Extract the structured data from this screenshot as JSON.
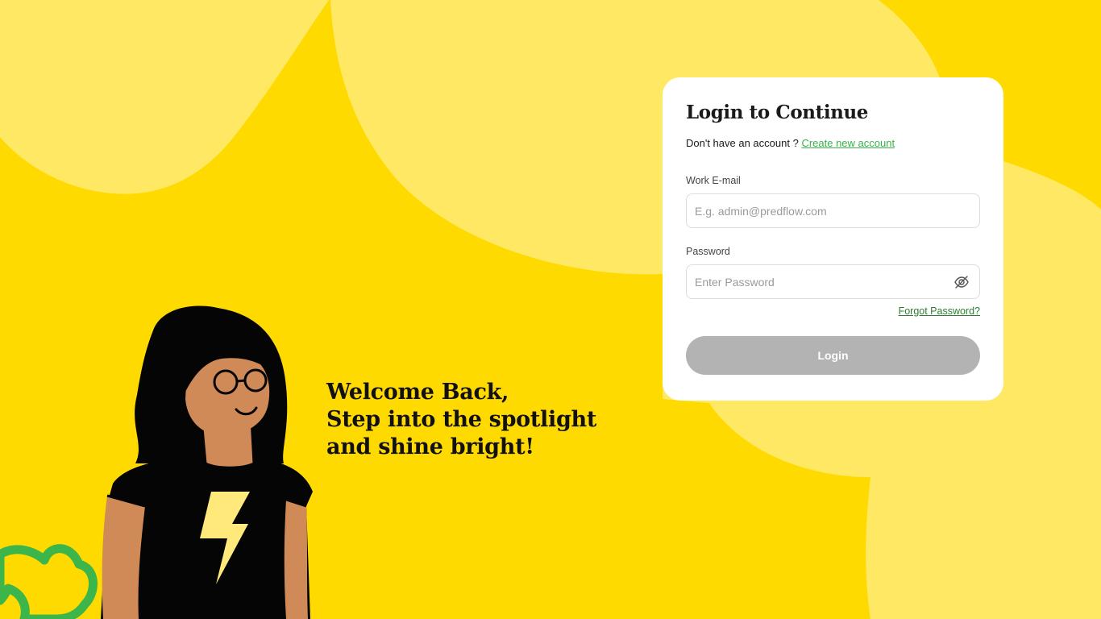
{
  "welcome": {
    "line1": "Welcome Back,",
    "line2": "Step into the spotlight",
    "line3": "and shine bright!"
  },
  "login_card": {
    "title": "Login to Continue",
    "signup_prompt": "Don't have an account ?",
    "signup_link": "Create new account",
    "email_label": "Work E-mail",
    "email_placeholder": "E.g. admin@predflow.com",
    "email_value": "",
    "password_label": "Password",
    "password_placeholder": "Enter Password",
    "password_value": "",
    "password_toggle_icon": "eye-off-icon",
    "forgot_link": "Forgot Password?",
    "login_button": "Login"
  },
  "colors": {
    "background": "#FFDA00",
    "background_shape": "#FFE964",
    "link_green": "#36B34A",
    "forgot_green": "#2E7D32",
    "button_disabled": "#B3B3B3",
    "card": "#FFFFFF"
  }
}
